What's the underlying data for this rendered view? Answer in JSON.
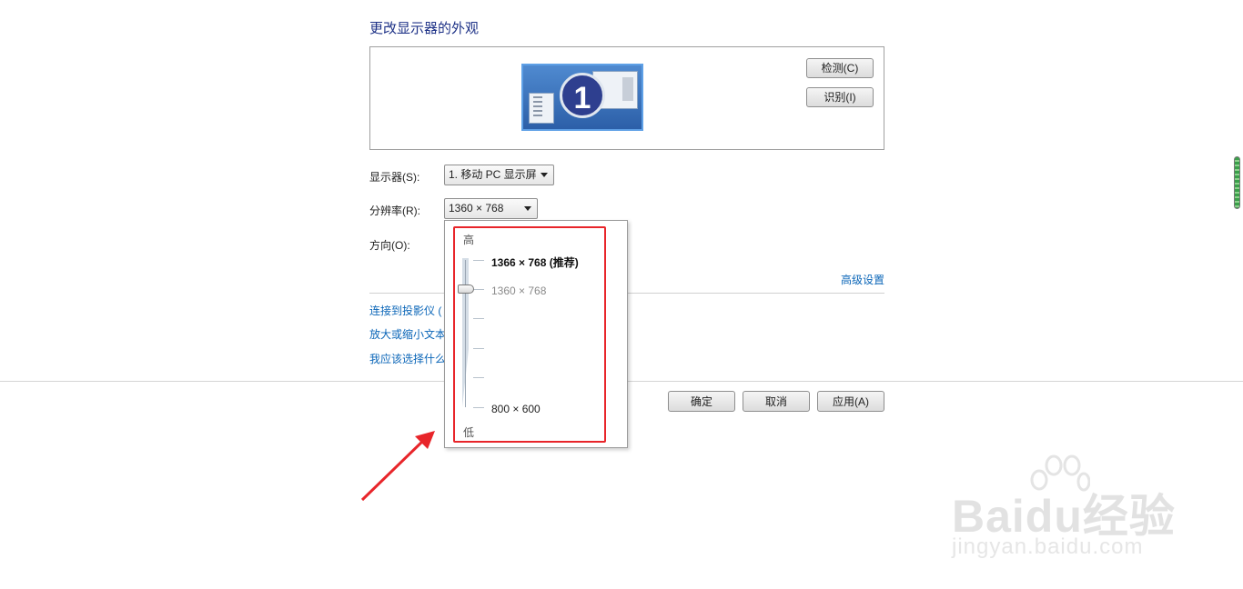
{
  "page": {
    "title": "更改显示器的外观",
    "monitor_number": "1"
  },
  "buttons": {
    "detect": "检测(C)",
    "identify": "识别(I)",
    "ok": "确定",
    "cancel": "取消",
    "apply": "应用(A)"
  },
  "settings": {
    "display_label": "显示器(S):",
    "display_value": "1. 移动 PC 显示屏",
    "resolution_label": "分辨率(R):",
    "resolution_value": "1360 × 768",
    "orientation_label": "方向(O):",
    "advanced_link": "高级设置"
  },
  "links": [
    "连接到投影仪 (",
    "放大或缩小文本",
    "我应该选择什么"
  ],
  "resolution_dropdown": {
    "high_label": "高",
    "low_label": "低",
    "options": {
      "recommended": "1366 × 768 (推荐)",
      "current": "1360 × 768",
      "lowest": "800 × 600"
    }
  },
  "watermark": {
    "logo": "Baidu经验",
    "url": "jingyan.baidu.com"
  },
  "colors": {
    "title": "#1e3287",
    "link": "#0b66b8",
    "annotation": "#e8252a"
  }
}
